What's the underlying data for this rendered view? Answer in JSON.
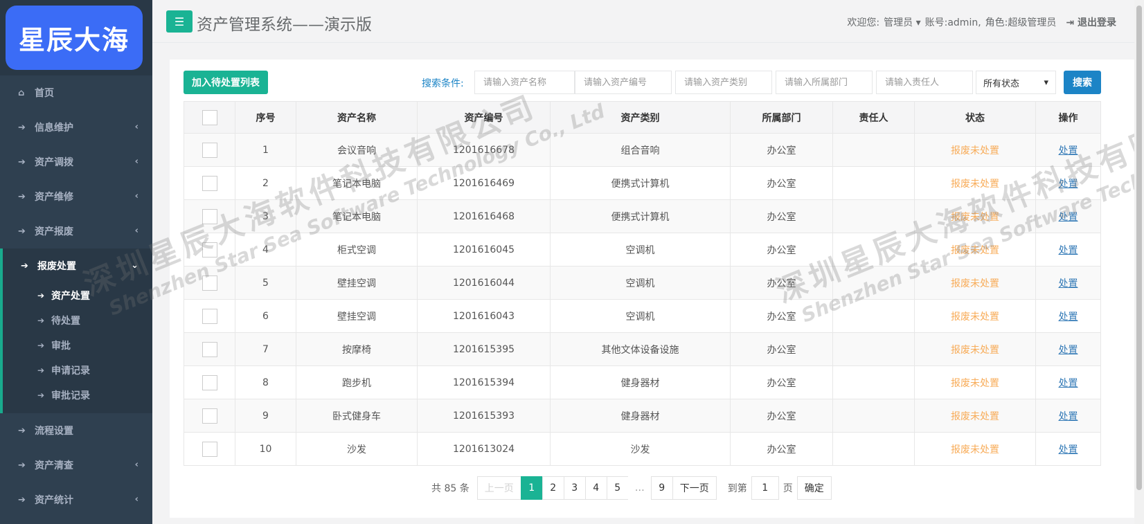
{
  "sidebar": {
    "logo_text": "星辰大海",
    "items": [
      {
        "label": "首页",
        "icon": "home-icon",
        "has_chevron": false
      },
      {
        "label": "信息维护",
        "icon": "arrow-right-icon",
        "has_chevron": true
      },
      {
        "label": "资产调拨",
        "icon": "arrow-right-icon",
        "has_chevron": true
      },
      {
        "label": "资产维修",
        "icon": "arrow-right-icon",
        "has_chevron": true
      },
      {
        "label": "资产报废",
        "icon": "arrow-right-icon",
        "has_chevron": true
      }
    ],
    "active_group": {
      "label": "报废处置",
      "subitems": [
        "资产处置",
        "待处置",
        "审批",
        "申请记录",
        "审批记录"
      ],
      "active_subitem": "资产处置"
    },
    "items_after": [
      {
        "label": "流程设置",
        "has_chevron": false
      },
      {
        "label": "资产清查",
        "has_chevron": true
      },
      {
        "label": "资产统计",
        "has_chevron": true
      }
    ]
  },
  "header": {
    "title": "资产管理系统——演示版",
    "welcome": "欢迎您:",
    "user_role_menu": "管理员",
    "account": "账号:admin,",
    "role": "角色:超级管理员",
    "logout": "退出登录"
  },
  "toolbar": {
    "add_button": "加入待处置列表",
    "search_label": "搜索条件:",
    "inputs": {
      "asset_name": "请输入资产名称",
      "asset_code": "请输入资产编号",
      "asset_category": "请输入资产类别",
      "department": "请输入所属部门",
      "owner": "请输入责任人"
    },
    "status_select": "所有状态",
    "search_button": "搜索"
  },
  "table": {
    "headers": [
      "",
      "序号",
      "资产名称",
      "资产编号",
      "资产类别",
      "所属部门",
      "责任人",
      "状态",
      "操作"
    ],
    "rows": [
      {
        "no": "1",
        "name": "会议音响",
        "code": "1201616678",
        "category": "组合音响",
        "dept": "办公室",
        "owner": "",
        "status": "报废未处置",
        "op": "处置"
      },
      {
        "no": "2",
        "name": "笔记本电脑",
        "code": "1201616469",
        "category": "便携式计算机",
        "dept": "办公室",
        "owner": "",
        "status": "报废未处置",
        "op": "处置"
      },
      {
        "no": "3",
        "name": "笔记本电脑",
        "code": "1201616468",
        "category": "便携式计算机",
        "dept": "办公室",
        "owner": "",
        "status": "报废未处置",
        "op": "处置"
      },
      {
        "no": "4",
        "name": "柜式空调",
        "code": "1201616045",
        "category": "空调机",
        "dept": "办公室",
        "owner": "",
        "status": "报废未处置",
        "op": "处置"
      },
      {
        "no": "5",
        "name": "壁挂空调",
        "code": "1201616044",
        "category": "空调机",
        "dept": "办公室",
        "owner": "",
        "status": "报废未处置",
        "op": "处置"
      },
      {
        "no": "6",
        "name": "壁挂空调",
        "code": "1201616043",
        "category": "空调机",
        "dept": "办公室",
        "owner": "",
        "status": "报废未处置",
        "op": "处置"
      },
      {
        "no": "7",
        "name": "按摩椅",
        "code": "1201615395",
        "category": "其他文体设备设施",
        "dept": "办公室",
        "owner": "",
        "status": "报废未处置",
        "op": "处置"
      },
      {
        "no": "8",
        "name": "跑步机",
        "code": "1201615394",
        "category": "健身器材",
        "dept": "办公室",
        "owner": "",
        "status": "报废未处置",
        "op": "处置"
      },
      {
        "no": "9",
        "name": "卧式健身车",
        "code": "1201615393",
        "category": "健身器材",
        "dept": "办公室",
        "owner": "",
        "status": "报废未处置",
        "op": "处置"
      },
      {
        "no": "10",
        "name": "沙发",
        "code": "1201613024",
        "category": "沙发",
        "dept": "办公室",
        "owner": "",
        "status": "报废未处置",
        "op": "处置"
      }
    ]
  },
  "pagination": {
    "total": "共 85 条",
    "prev": "上一页",
    "pages": [
      "1",
      "2",
      "3",
      "4",
      "5"
    ],
    "current": "1",
    "ellipsis": "…",
    "last": "9",
    "next": "下一页",
    "goto_label": "到第",
    "goto_value": "1",
    "page_unit": "页",
    "confirm": "确定"
  },
  "watermark": {
    "cn": "深圳星辰大海软件科技有限公司",
    "en": "Shenzhen Star Sea Software Technology Co., Ltd"
  },
  "colors": {
    "sidebar_bg": "#2f4050",
    "accent_green": "#1ab394",
    "accent_blue": "#1c84c6",
    "status_orange": "#f8ac59",
    "logo_blue": "#3b6cf6"
  }
}
